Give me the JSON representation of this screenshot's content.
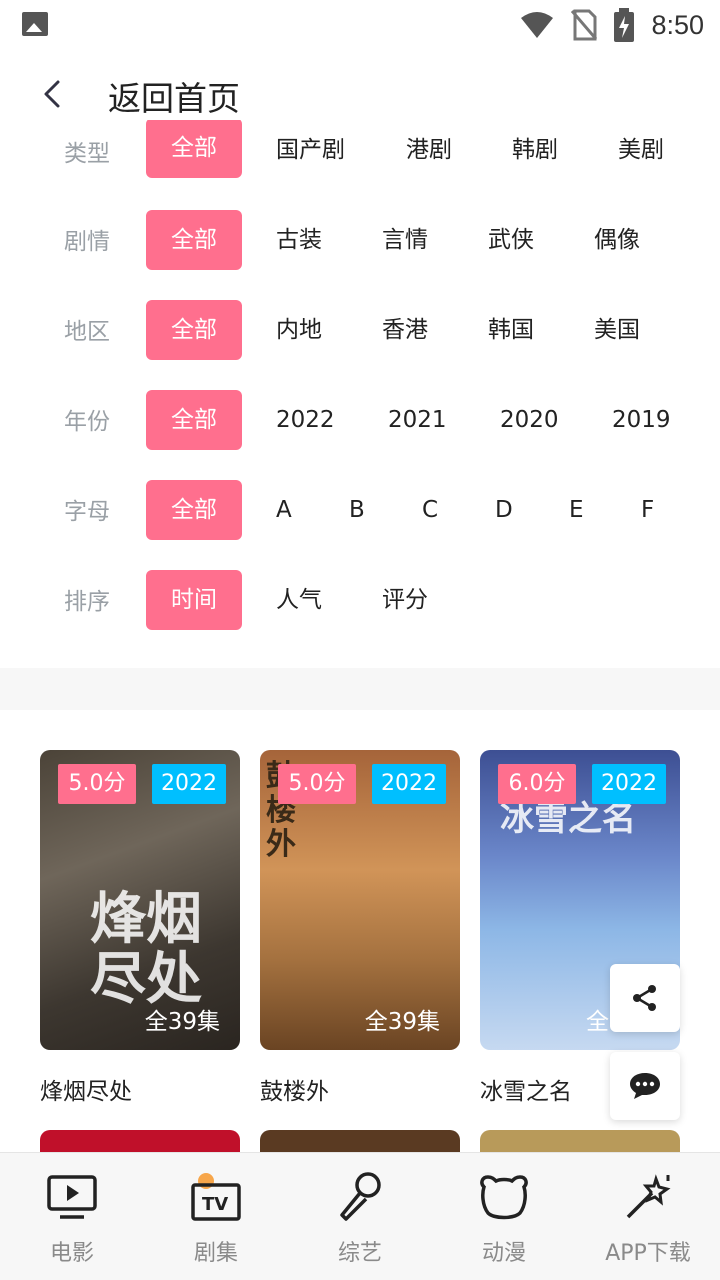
{
  "status_bar": {
    "time": "8:50"
  },
  "header": {
    "title": "返回首页"
  },
  "filters": [
    {
      "label": "类型",
      "options": [
        "全部",
        "国产剧",
        "港剧",
        "韩剧",
        "美剧"
      ]
    },
    {
      "label": "剧情",
      "options": [
        "全部",
        "古装",
        "言情",
        "武侠",
        "偶像"
      ]
    },
    {
      "label": "地区",
      "options": [
        "全部",
        "内地",
        "香港",
        "韩国",
        "美国"
      ]
    },
    {
      "label": "年份",
      "options": [
        "全部",
        "2022",
        "2021",
        "2020",
        "2019"
      ]
    },
    {
      "label": "字母",
      "options": [
        "全部",
        "A",
        "B",
        "C",
        "D",
        "E",
        "F"
      ]
    },
    {
      "label": "排序",
      "options": [
        "时间",
        "人气",
        "评分"
      ]
    }
  ],
  "cards": [
    {
      "title": "烽烟尽处",
      "score": "5.0分",
      "year": "2022",
      "episodes": "全39集",
      "poster_text": "烽烟尽处"
    },
    {
      "title": "鼓楼外",
      "score": "5.0分",
      "year": "2022",
      "episodes": "全39集",
      "poster_text": "鼓楼外"
    },
    {
      "title": "冰雪之名",
      "score": "6.0分",
      "year": "2022",
      "episodes": "全",
      "poster_text": "冰雪之名"
    }
  ],
  "nav": [
    {
      "label": "电影",
      "icon": "movie-screen-icon"
    },
    {
      "label": "剧集",
      "icon": "tv-icon"
    },
    {
      "label": "综艺",
      "icon": "microphone-icon"
    },
    {
      "label": "动漫",
      "icon": "bear-icon"
    },
    {
      "label": "APP下载",
      "icon": "magic-wand-icon"
    }
  ],
  "colors": {
    "accent_pink": "#ff6f8e",
    "accent_blue": "#00bfff"
  }
}
